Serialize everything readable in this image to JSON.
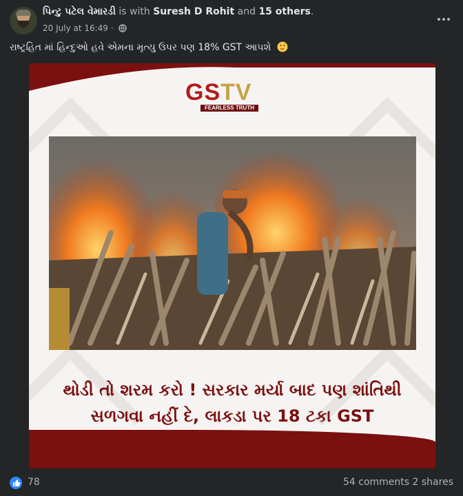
{
  "post": {
    "author": "પિન્ટુ પટેલ વેમારડી",
    "with_text": "is with",
    "tagged_person": "Suresh D Rohit",
    "and_text": "and",
    "tagged_others": "15 others",
    "period": ".",
    "timestamp": "20 July at 16:49",
    "dot_separator": "·",
    "privacy_icon": "globe-icon",
    "caption": "રાષ્ટ્રહિત માં હિન્દુઓ હવે એમના મૃત્યુ ઉપર પણ 18% GST આપશે",
    "caption_emoji": "thinking-face"
  },
  "image": {
    "logo_main_gs": "GS",
    "logo_main_tv": "TV",
    "logo_tagline": "FEARLESS TRUTH",
    "headline_line1": "થોડી તો શરમ કરો ! સરકાર મર્યા બાદ પણ શાંતિથી",
    "headline_line2": "સળગવા નહીં દે, લાકડા પર 18 ટકા GST",
    "colors": {
      "maroon": "#7a1010",
      "gold": "#c8a24a",
      "red": "#b11c1c"
    }
  },
  "footer": {
    "like_count": "78",
    "comments": "54 comments",
    "shares": "2 shares"
  },
  "colors": {
    "background": "#242526",
    "text": "#e4e6eb",
    "muted": "#b0b3b8",
    "like_blue": "#2d88ff"
  }
}
